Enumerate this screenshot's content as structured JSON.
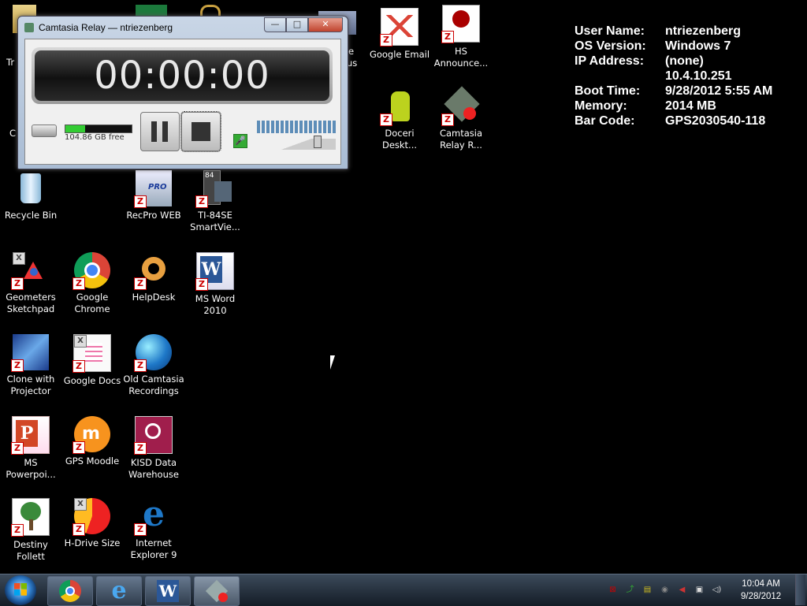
{
  "sysinfo": [
    {
      "k": "User Name:",
      "v": "ntriezenberg"
    },
    {
      "k": "OS Version:",
      "v": "Windows 7"
    },
    {
      "k": "IP Address:",
      "v": "(none)"
    },
    {
      "k": "",
      "v": "10.4.10.251"
    },
    {
      "k": "Boot Time:",
      "v": "9/28/2012 5:55 AM"
    },
    {
      "k": "Memory:",
      "v": "2014 MB"
    },
    {
      "k": "Bar Code:",
      "v": "GPS2030540-118"
    }
  ],
  "partial_labels": {
    "left_tr": "Tr",
    "left_c": "C",
    "right_e": "e",
    "right_us": "us"
  },
  "icons": {
    "google_email": "Google Email",
    "hs_announce": "HS Announce...",
    "doceri": "Doceri Deskt...",
    "camtasia_relay_r": "Camtasia Relay R...",
    "recycle_bin": "Recycle Bin",
    "recpro": "RecPro WEB",
    "ti84": "TI-84SE SmartVie...",
    "geometers": "Geometers Sketchpad",
    "chrome": "Google Chrome",
    "helpdesk": "HelpDesk",
    "msword": "MS Word 2010",
    "clone": "Clone with Projector",
    "gdocs": "Google Docs",
    "old_camtasia": "Old Camtasia Recordings",
    "ms_ppt": "MS Powerpoi...",
    "gps_moodle": "GPS Moodle",
    "kisd": "KISD Data Warehouse",
    "destiny": "Destiny Follett",
    "hdrive": "H-Drive Size",
    "ie9": "Internet Explorer 9"
  },
  "icon_glyphs": {
    "recpro_badge": "PRO",
    "ti_badge": "84",
    "zen": "Z",
    "x": "X"
  },
  "camtasia": {
    "title": "Camtasia Relay — ntriezenberg",
    "timer": "00:00:00",
    "disk_free": "104.86 GB free",
    "disk_fill": 0.3,
    "controls": {
      "minimize": "—",
      "maximize": "□",
      "close": "✕",
      "mic": "🎤"
    }
  },
  "taskbar": {
    "tray_icons": [
      "pdf-icon",
      "network-icon",
      "security-icon",
      "update-icon",
      "speaker-mute-icon",
      "network-monitor-icon",
      "volume-icon"
    ],
    "tray_glyphs": [
      "⊠",
      "⤴",
      "▤",
      "◉",
      "◀",
      "▣",
      "◁)"
    ],
    "time": "10:04 AM",
    "date": "9/28/2012"
  },
  "colors": {
    "zen_badge": "#cc0000",
    "chrome_red": "#db4437",
    "ie_blue": "#1e78c8"
  }
}
